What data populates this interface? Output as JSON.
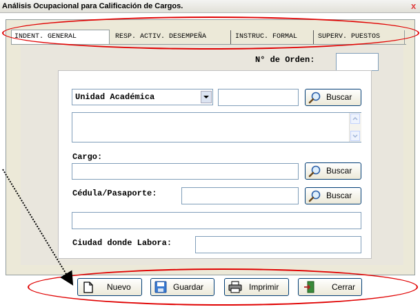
{
  "window": {
    "title": "Análisis Ocupacional para Calificación de Cargos.",
    "close_glyph": "x"
  },
  "tabs": [
    {
      "label": "INDENT. GENERAL"
    },
    {
      "label": "RESP. ACTIV. DESEMPEÑA"
    },
    {
      "label": "INSTRUC. FORMAL"
    },
    {
      "label": "SUPERV.  PUESTOS"
    }
  ],
  "orden": {
    "label": "N° de Orden:",
    "value": ""
  },
  "unidad": {
    "selected": "Unidad Académica",
    "code_value": "",
    "buscar_label": "Buscar",
    "desc_value": ""
  },
  "cargo": {
    "label": "Cargo:",
    "value": "",
    "buscar_label": "Buscar"
  },
  "cedula": {
    "label": "Cédula/Pasaporte:",
    "value": "",
    "buscar_label": "Buscar",
    "name_value": ""
  },
  "ciudad": {
    "label": "Ciudad donde Labora:",
    "value": ""
  },
  "toolbar": {
    "nuevo_label": "Nuevo",
    "guardar_label": "Guardar",
    "imprimir_label": "Imprimir",
    "cerrar_label": "Cerrar"
  },
  "colors": {
    "annotation": "#e00000",
    "panel": "#ece9d8",
    "accent": "#003c74"
  }
}
